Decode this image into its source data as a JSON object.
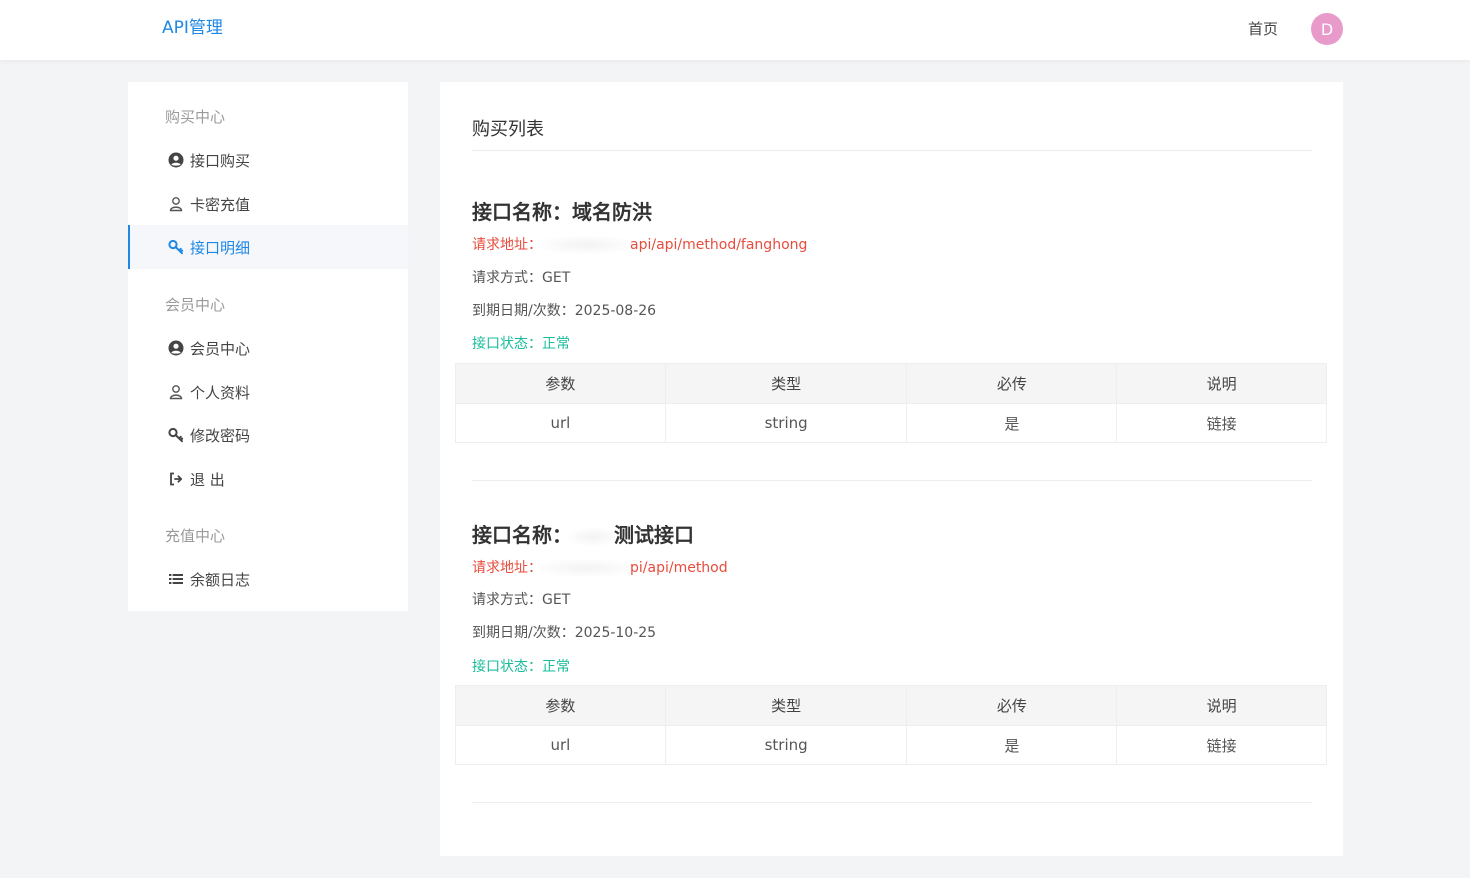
{
  "header": {
    "logo": "API管理",
    "home": "首页",
    "avatar_letter": "D"
  },
  "sidebar": {
    "groups": [
      {
        "title": "购买中心",
        "items": [
          {
            "label": "接口购买",
            "icon": "user-circle-icon"
          },
          {
            "label": "卡密充值",
            "icon": "user-outline-icon"
          },
          {
            "label": "接口明细",
            "icon": "key-icon",
            "active": true
          }
        ]
      },
      {
        "title": "会员中心",
        "items": [
          {
            "label": "会员中心",
            "icon": "user-circle-icon"
          },
          {
            "label": "个人资料",
            "icon": "user-outline-icon"
          },
          {
            "label": "修改密码",
            "icon": "key-icon"
          },
          {
            "label": "退 出",
            "icon": "sign-out-icon"
          }
        ]
      },
      {
        "title": "充值中心",
        "items": [
          {
            "label": "余额日志",
            "icon": "list-icon"
          }
        ]
      }
    ]
  },
  "content": {
    "title": "购买列表",
    "apis": [
      {
        "name_label": "接口名称：",
        "name": "域名防洪",
        "url_label": "请求地址：",
        "url": "api/api/method/fanghong",
        "method_label": "请求方式：",
        "method": "GET",
        "expiry_label": "到期日期/次数：",
        "expiry": "2025-08-26",
        "status_label": "接口状态：",
        "status": "正常",
        "table": {
          "headers": [
            "参数",
            "类型",
            "必传",
            "说明"
          ],
          "rows": [
            [
              "url",
              "string",
              "是",
              "链接"
            ]
          ]
        }
      },
      {
        "name_label": "接口名称：",
        "name": "测试接口",
        "url_label": "请求地址：",
        "url": "pi/api/method",
        "method_label": "请求方式：",
        "method": "GET",
        "expiry_label": "到期日期/次数：",
        "expiry": "2025-10-25",
        "status_label": "接口状态：",
        "status": "正常",
        "table": {
          "headers": [
            "参数",
            "类型",
            "必传",
            "说明"
          ],
          "rows": [
            [
              "url",
              "string",
              "是",
              "链接"
            ]
          ]
        }
      }
    ]
  },
  "colors": {
    "accent": "#1e88e5",
    "url_red": "#e84c3d",
    "status_green": "#1abc9c",
    "avatar_pink": "#e89acb"
  }
}
